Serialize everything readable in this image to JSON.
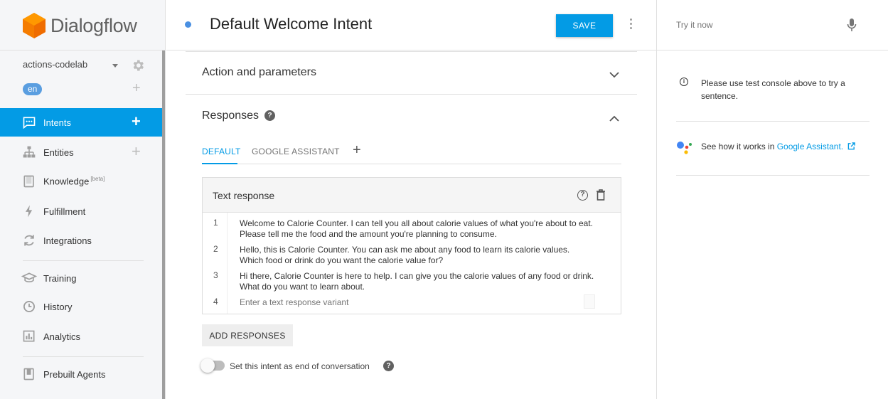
{
  "app": {
    "name": "Dialogflow"
  },
  "sidebar": {
    "agent_name": "actions-codelab",
    "language": "en",
    "items": [
      {
        "label": "Intents",
        "icon": "chat-bubble-icon",
        "active": true,
        "has_add": true
      },
      {
        "label": "Entities",
        "icon": "hierarchy-icon",
        "active": false,
        "has_add": true
      },
      {
        "label": "Knowledge",
        "badge": "[beta]",
        "icon": "book-icon",
        "active": false,
        "has_add": false
      },
      {
        "label": "Fulfillment",
        "icon": "lightning-icon",
        "active": false,
        "has_add": false
      },
      {
        "label": "Integrations",
        "icon": "sync-icon",
        "active": false,
        "has_add": false
      },
      {
        "label": "Training",
        "icon": "graduation-cap-icon",
        "active": false,
        "has_add": false
      },
      {
        "label": "History",
        "icon": "clock-icon",
        "active": false,
        "has_add": false
      },
      {
        "label": "Analytics",
        "icon": "bar-chart-icon",
        "active": false,
        "has_add": false
      },
      {
        "label": "Prebuilt Agents",
        "icon": "prebuilt-book-icon",
        "active": false,
        "has_add": false
      }
    ]
  },
  "header": {
    "intent_title": "Default Welcome Intent",
    "save_label": "SAVE"
  },
  "sections": {
    "action_params_title": "Action and parameters",
    "responses_title": "Responses"
  },
  "tabs": [
    {
      "label": "DEFAULT",
      "active": true
    },
    {
      "label": "GOOGLE ASSISTANT",
      "active": false
    }
  ],
  "text_response": {
    "title": "Text response",
    "rows": [
      {
        "num": "1",
        "text": "Welcome to Calorie Counter. I can tell you all about calorie values of what you're about to eat. Please tell me the food and the amount you're planning to consume."
      },
      {
        "num": "2",
        "text": "Hello, this is Calorie Counter. You can ask me about any food to learn its calorie values. Which food or drink do you want the calorie value for?"
      },
      {
        "num": "3",
        "text": "Hi there, Calorie Counter is here to help. I can give you the calorie values of any food or drink. What do you want to learn about."
      }
    ],
    "new_row_num": "4",
    "new_row_placeholder": "Enter a text response variant"
  },
  "add_responses_label": "ADD RESPONSES",
  "end_conversation_label": "Set this intent as end of conversation",
  "end_conversation_on": false,
  "right_panel": {
    "try_placeholder": "Try it now",
    "info_text": "Please use test console above to try a sentence.",
    "ga_prefix": "See how it works in ",
    "ga_link": "Google Assistant."
  },
  "colors": {
    "accent": "#039be5",
    "logo_orange": "#f57c00"
  }
}
